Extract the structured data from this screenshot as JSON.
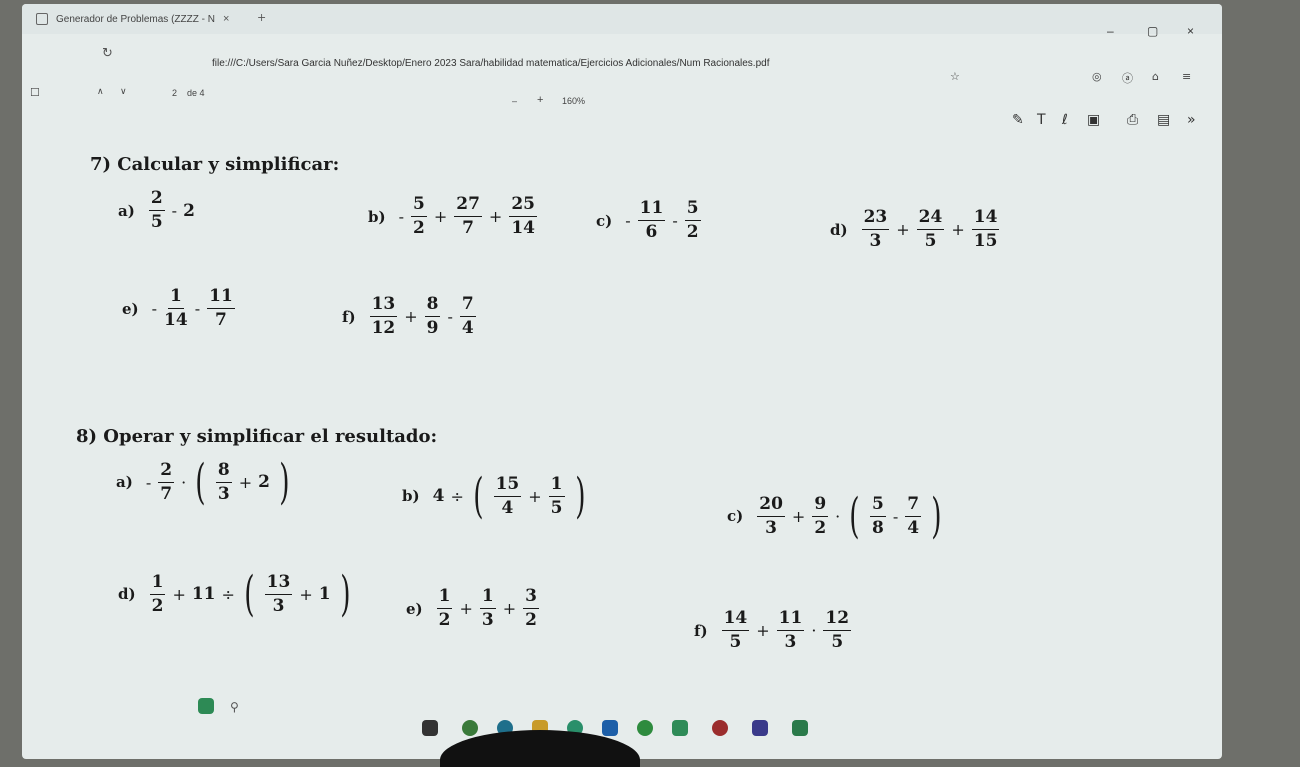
{
  "browser": {
    "tab_title": "Generador de Problemas (ZZZZ - N",
    "tab_close": "×",
    "new_tab": "+",
    "url": "file:///C:/Users/Sara Garcia Nuñez/Desktop/Enero 2023 Sara/habilidad matematica/Ejercicios Adicionales/Num Racionales.pdf",
    "min_glyph": "–",
    "max_glyph": "▢",
    "close_glyph": "×"
  },
  "pdf_toolbar": {
    "page_current": "2",
    "page_of": "de 4",
    "zoom": "160%",
    "zoom_minus": "–",
    "zoom_plus": "+"
  },
  "section7": {
    "heading": "7) Calcular y simplificar:",
    "a": "a)",
    "b": "b)",
    "c": "c)",
    "d": "d)",
    "e": "e)",
    "f": "f)"
  },
  "section8": {
    "heading": "8) Operar y simplificar el resultado:",
    "a": "a)",
    "b": "b)",
    "c": "c)",
    "d": "d)",
    "e": "e)",
    "f": "f)"
  },
  "n": {
    "p7a": [
      "2",
      "5",
      "2"
    ],
    "p7b": [
      "5",
      "2",
      "27",
      "7",
      "25",
      "14"
    ],
    "p7c": [
      "11",
      "6",
      "5",
      "2"
    ],
    "p7d": [
      "23",
      "3",
      "24",
      "5",
      "14",
      "15"
    ],
    "p7e": [
      "1",
      "14",
      "11",
      "7"
    ],
    "p7f": [
      "13",
      "12",
      "8",
      "9",
      "7",
      "4"
    ],
    "p8a": [
      "2",
      "7",
      "8",
      "3",
      "2"
    ],
    "p8b": [
      "4",
      "15",
      "4",
      "1",
      "5"
    ],
    "p8c": [
      "20",
      "3",
      "9",
      "2",
      "5",
      "8",
      "7",
      "4"
    ],
    "p8d": [
      "1",
      "2",
      "11",
      "13",
      "3",
      "1"
    ],
    "p8e": [
      "1",
      "2",
      "1",
      "3",
      "3",
      "2"
    ],
    "p8f": [
      "14",
      "5",
      "11",
      "3",
      "12",
      "5"
    ]
  },
  "ops": {
    "minus": "-",
    "plus": "+",
    "dot": "·",
    "div": "÷",
    "lp": "(",
    "rp": ")"
  },
  "taskbar": {
    "search_icon": "magnifier-icon"
  }
}
